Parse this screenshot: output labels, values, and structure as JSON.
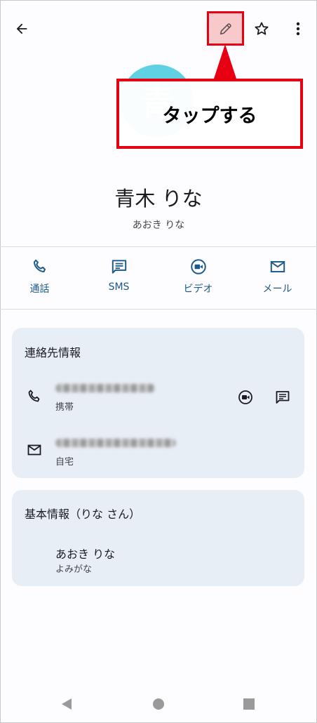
{
  "callout": {
    "text": "タップする"
  },
  "contact": {
    "avatar_char": "青",
    "name": "青木 りな",
    "reading": "あおき りな"
  },
  "actions": [
    {
      "label": "通話",
      "icon": "phone-icon"
    },
    {
      "label": "SMS",
      "icon": "message-icon"
    },
    {
      "label": "ビデオ",
      "icon": "video-icon"
    },
    {
      "label": "メール",
      "icon": "mail-icon"
    }
  ],
  "contact_info": {
    "title": "連絡先情報",
    "phone_type": "携帯",
    "email_type": "自宅"
  },
  "basic_info": {
    "title": "基本情報（りな さん）",
    "value": "あおき りな",
    "label": "よみがな"
  },
  "colors": {
    "accent": "#1a5a8a",
    "highlight": "#e60012",
    "avatar": "#5fd1e3",
    "card": "#e7eef5"
  }
}
